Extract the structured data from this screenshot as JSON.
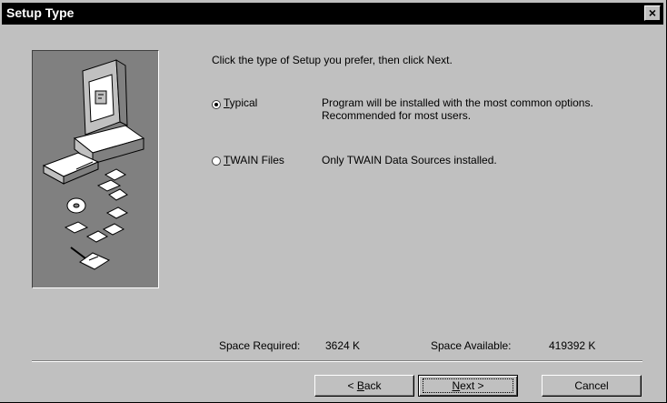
{
  "window": {
    "title": "Setup Type",
    "close_label": "×"
  },
  "instructions": "Click the type of Setup you prefer, then click Next.",
  "options": [
    {
      "label": "Typical",
      "mnemonic": "T",
      "rest": "ypical",
      "description_line1": "Program will be installed with the most common options.",
      "description_line2": "Recommended for most users.",
      "selected": true
    },
    {
      "label": "TWAIN Files",
      "mnemonic": "T",
      "rest": "WAIN Files",
      "description_line1": "Only TWAIN Data Sources installed.",
      "selected": false
    }
  ],
  "space": {
    "required_label": "Space Required:",
    "required_value": "3624 K",
    "available_label": "Space Available:",
    "available_value": "419392 K"
  },
  "buttons": {
    "back": {
      "prefix": "< ",
      "mnemonic": "B",
      "rest": "ack"
    },
    "next": {
      "mnemonic": "N",
      "rest": "ext",
      "suffix": " >"
    },
    "cancel": "Cancel"
  },
  "colors": {
    "face": "#c0c0c0",
    "titlebar": "#000000",
    "illustration_bg": "#808080"
  }
}
